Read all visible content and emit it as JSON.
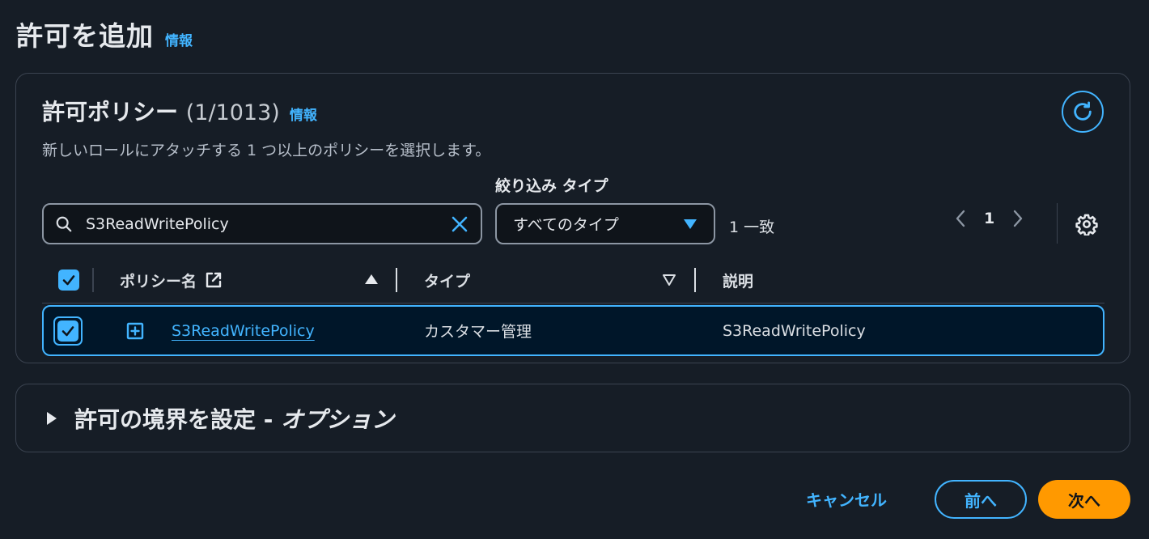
{
  "page": {
    "title": "許可を追加",
    "info": "情報"
  },
  "policies": {
    "title": "許可ポリシー",
    "count": "(1/1013)",
    "info": "情報",
    "description": "新しいロールにアタッチする 1 つ以上のポリシーを選択します。",
    "filter_label": "絞り込み タイプ",
    "search_value": "S3ReadWritePolicy",
    "type_select": "すべてのタイプ",
    "match_count": "1 一致",
    "page_number": "1",
    "columns": {
      "name": "ポリシー名",
      "type": "タイプ",
      "description": "説明"
    },
    "rows": [
      {
        "name": "S3ReadWritePolicy",
        "type": "カスタマー管理",
        "description": "S3ReadWritePolicy",
        "selected": true
      }
    ]
  },
  "boundary": {
    "title": "許可の境界を設定 -",
    "optional": "オプション"
  },
  "footer": {
    "cancel": "キャンセル",
    "prev": "前へ",
    "next": "次へ"
  },
  "colors": {
    "accent": "#42b4ff",
    "primary_button": "#ff9900",
    "background": "#161d26",
    "border": "#3b4350"
  }
}
